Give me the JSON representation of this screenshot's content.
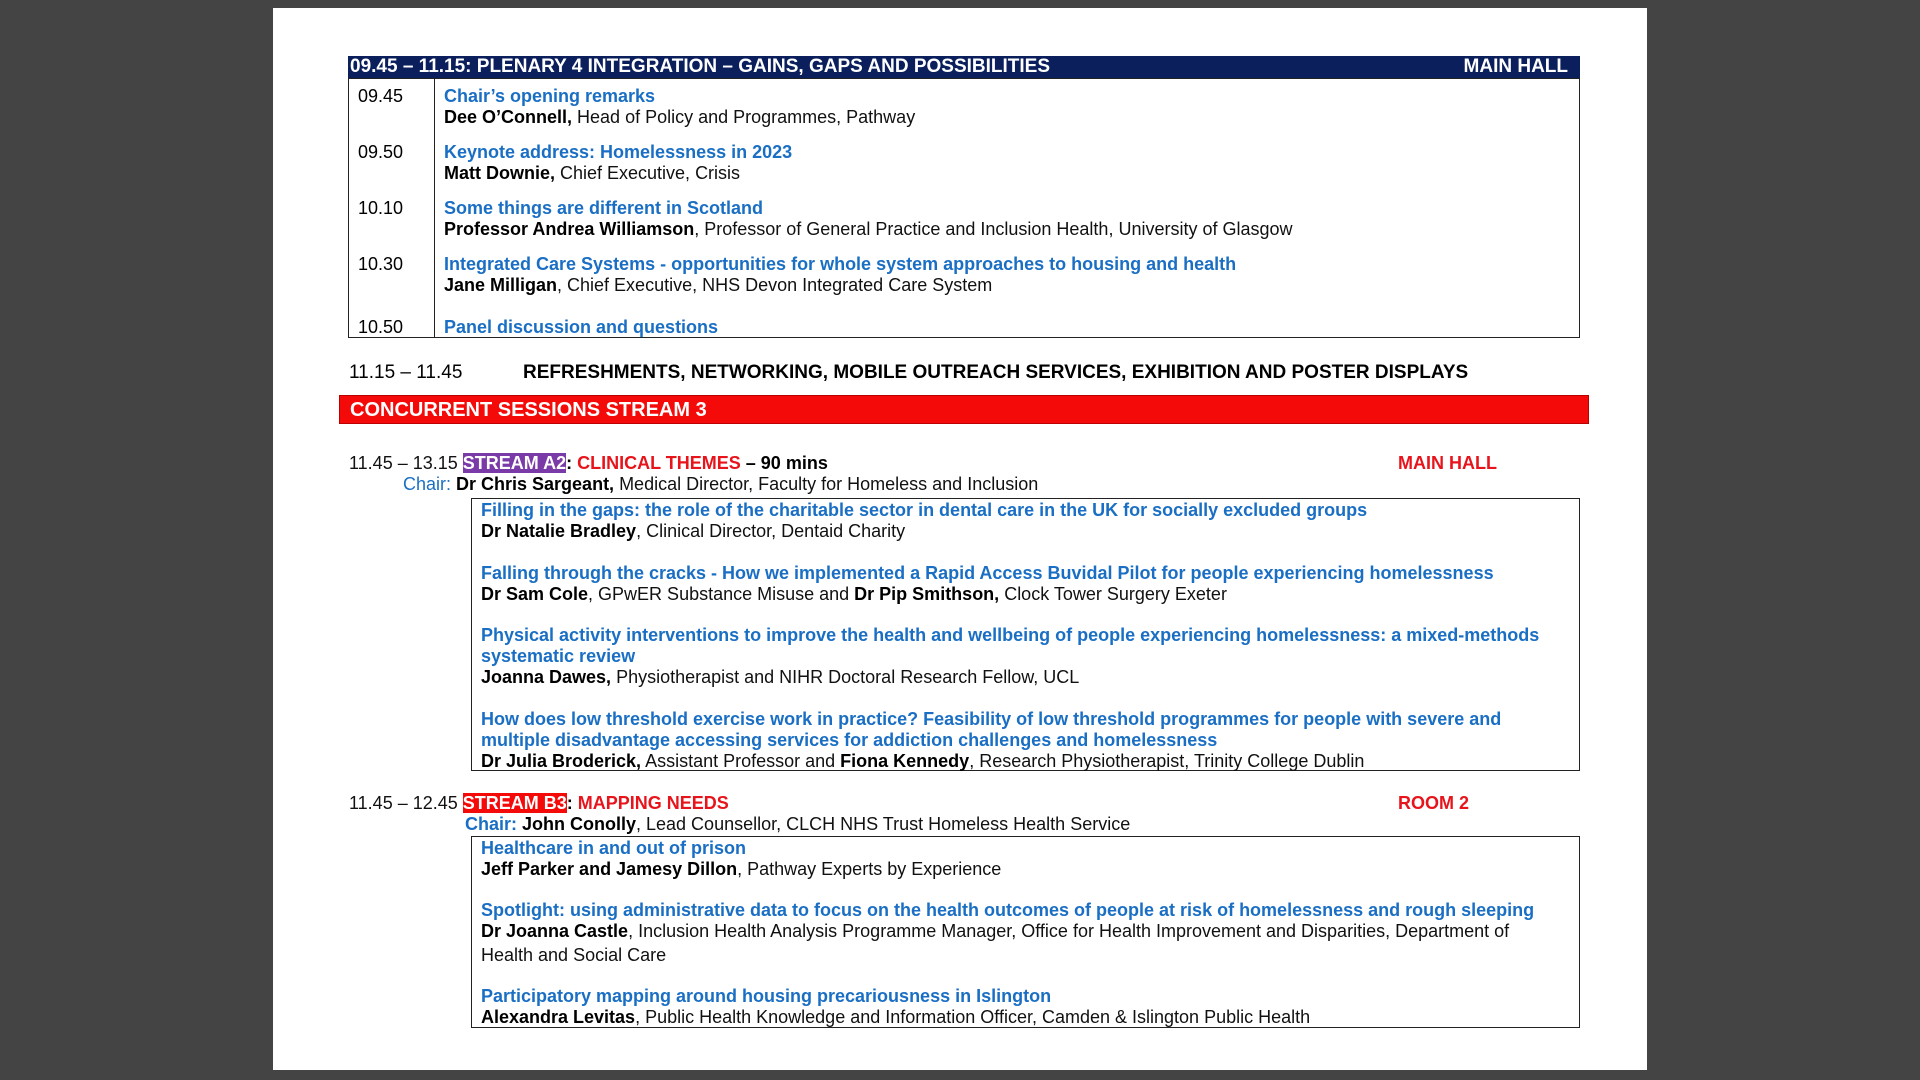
{
  "plenary": {
    "header": "09.45 – 11.15: PLENARY 4 INTEGRATION – GAINS, GAPS AND POSSIBILITIES",
    "location": "MAIN HALL",
    "items": [
      {
        "time": "09.45",
        "title": "Chair’s opening remarks",
        "speaker": "Dee O’Connell,",
        "role": " Head of Policy and Programmes, Pathway"
      },
      {
        "time": "09.50",
        "title": "Keynote address:  Homelessness in 2023",
        "speaker": "Matt Downie,",
        "role": " Chief Executive, Crisis"
      },
      {
        "time": "10.10",
        "title": "Some things are different in Scotland",
        "speaker": "Professor Andrea Williamson",
        "role": ", Professor of General Practice and Inclusion Health, University of Glasgow"
      },
      {
        "time": "10.30",
        "title": "Integrated Care Systems - opportunities for whole system approaches to housing and health",
        "speaker": "Jane Milligan",
        "role": ", Chief Executive, NHS Devon Integrated Care System"
      },
      {
        "time": "10.50",
        "title": "Panel discussion and questions"
      }
    ]
  },
  "break": {
    "time": "11.15 – 11.45",
    "label": "REFRESHMENTS, NETWORKING, MOBILE OUTREACH SERVICES, EXHIBITION AND POSTER DISPLAYS"
  },
  "concurrent_bar": "CONCURRENT SESSIONS STREAM 3",
  "streamA2": {
    "time": "11.45 – 13.15 ",
    "tag": "STREAM A2",
    "sep": ": ",
    "theme": "CLINICAL THEMES",
    "duration": " – 90 mins",
    "location": "MAIN HALL",
    "chair_label": "Chair: ",
    "chair_name": "Dr Chris Sargeant,",
    "chair_role": " Medical Director, Faculty for Homeless and Inclusion",
    "talks": [
      {
        "title": "Filling in the gaps: the role of the charitable sector in dental care in the UK for socially excluded groups",
        "speaker": "Dr Natalie Bradley",
        "role": ", Clinical Director, Dentaid Charity"
      },
      {
        "title": "Falling through the cracks - How we implemented a Rapid Access Buvidal Pilot for people experiencing homelessness",
        "speaker": "Dr Sam Cole",
        "role": ", GPwER Substance Misuse and ",
        "speaker2": "Dr Pip Smithson,",
        "role2": " Clock Tower Surgery Exeter"
      },
      {
        "title_line1": "Physical activity interventions to improve the health and wellbeing of people experiencing homelessness: a mixed-methods",
        "title_line2": "systematic review",
        "speaker": "Joanna Dawes,",
        "role": " Physiotherapist and NIHR Doctoral Research Fellow, UCL"
      },
      {
        "title_line1": "How does low threshold exercise work in practice? Feasibility of low threshold programmes for people with severe and",
        "title_line2": "multiple disadvantage accessing services for addiction challenges and homelessness",
        "speaker": "Dr Julia Broderick,",
        "role": " Assistant Professor and ",
        "speaker2": "Fiona Kennedy",
        "role2": ", Research Physiotherapist, Trinity College Dublin"
      }
    ]
  },
  "streamB3": {
    "time": "11.45 – 12.45 ",
    "tag": "STREAM B3",
    "sep": ": ",
    "theme": "MAPPING NEEDS",
    "location": "ROOM 2",
    "chair_label": "Chair: ",
    "chair_name": "John Conolly",
    "chair_role": ", Lead Counsellor, CLCH NHS Trust Homeless Health Service",
    "talks": [
      {
        "title": "Healthcare in and out of prison",
        "speaker": "Jeff Parker and Jamesy Dillon",
        "role": ", Pathway Experts by Experience"
      },
      {
        "title": "Spotlight: using administrative data to focus on the health outcomes of people at risk of homelessness and rough sleeping",
        "speaker": "Dr Joanna Castle",
        "role": ", Inclusion Health Analysis Programme Manager, Office for Health Improvement and Disparities, Department of",
        "role_line2": "Health and Social Care"
      },
      {
        "title": "Participatory mapping around housing precariousness in Islington",
        "speaker": "Alexandra Levitas",
        "role": ", Public Health Knowledge and Information Officer, Camden & Islington Public Health"
      }
    ]
  }
}
